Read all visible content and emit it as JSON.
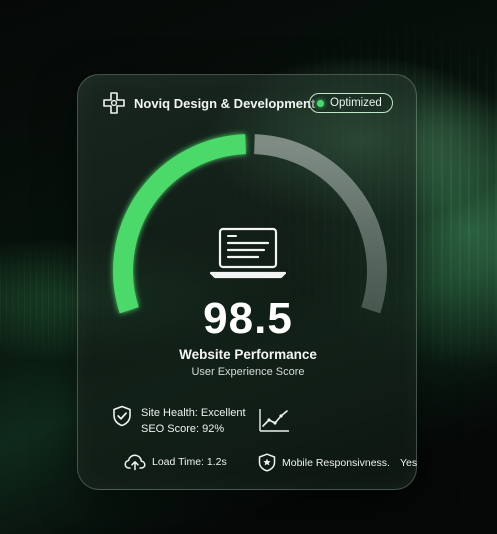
{
  "brand": {
    "name": "Noviq Design & Development"
  },
  "badge": {
    "label": "Optimized",
    "color": "#47dc6e"
  },
  "gauge": {
    "score": "98.5",
    "title": "Website Performance",
    "subtitle": "User Experience Score",
    "fill_fraction": 0.5,
    "active_color": "#4cd96b",
    "track_color": "#8c9a92",
    "icon": "laptop-icon"
  },
  "stats": {
    "health": "Site Health: Excellent",
    "seo": "SEO Score: 92%",
    "load_time": "Load Time: 1.2s",
    "mobile_label": "Mobile Responsivness.",
    "mobile_value": "Yes"
  },
  "icons": {
    "logo": "medical-cross-icon",
    "health": "shield-check-icon",
    "trend": "trend-chart-icon",
    "load": "cloud-upload-icon",
    "mobile": "star-badge-icon"
  }
}
